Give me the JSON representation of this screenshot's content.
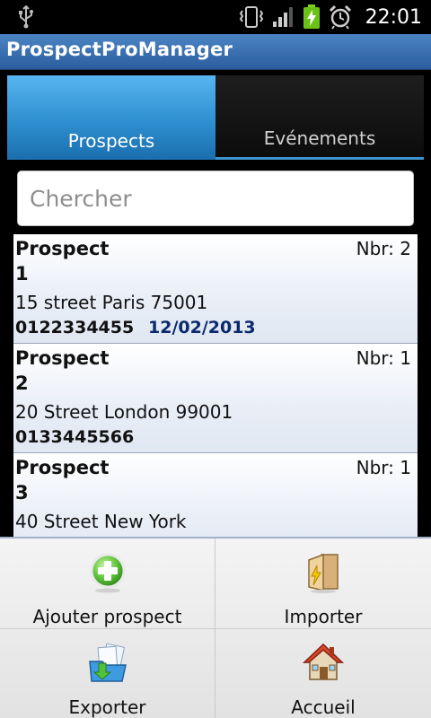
{
  "status": {
    "time": "22:01"
  },
  "app": {
    "title": "ProspectProManager"
  },
  "tabs": [
    {
      "label": "Prospects",
      "active": true
    },
    {
      "label": "Evénements",
      "active": false
    }
  ],
  "search": {
    "placeholder": "Chercher",
    "value": ""
  },
  "prospects": [
    {
      "name": "Prospect\n1",
      "nbr": "Nbr: 2",
      "address": "15 street Paris 75001",
      "phone": "0122334455",
      "date": "12/02/2013"
    },
    {
      "name": "Prospect\n2",
      "nbr": "Nbr: 1",
      "address": "20 Street London 99001",
      "phone": "0133445566",
      "date": ""
    },
    {
      "name": "Prospect\n3",
      "nbr": "Nbr: 1",
      "address": "40 Street New York",
      "phone": "",
      "date": ""
    }
  ],
  "menu": {
    "add": "Ajouter prospect",
    "import": "Importer",
    "export": "Exporter",
    "home": "Accueil"
  },
  "colors": {
    "title_bar": "#3a72b5",
    "tab_active": "#3ea1e0",
    "date_text": "#0b2a6e"
  }
}
